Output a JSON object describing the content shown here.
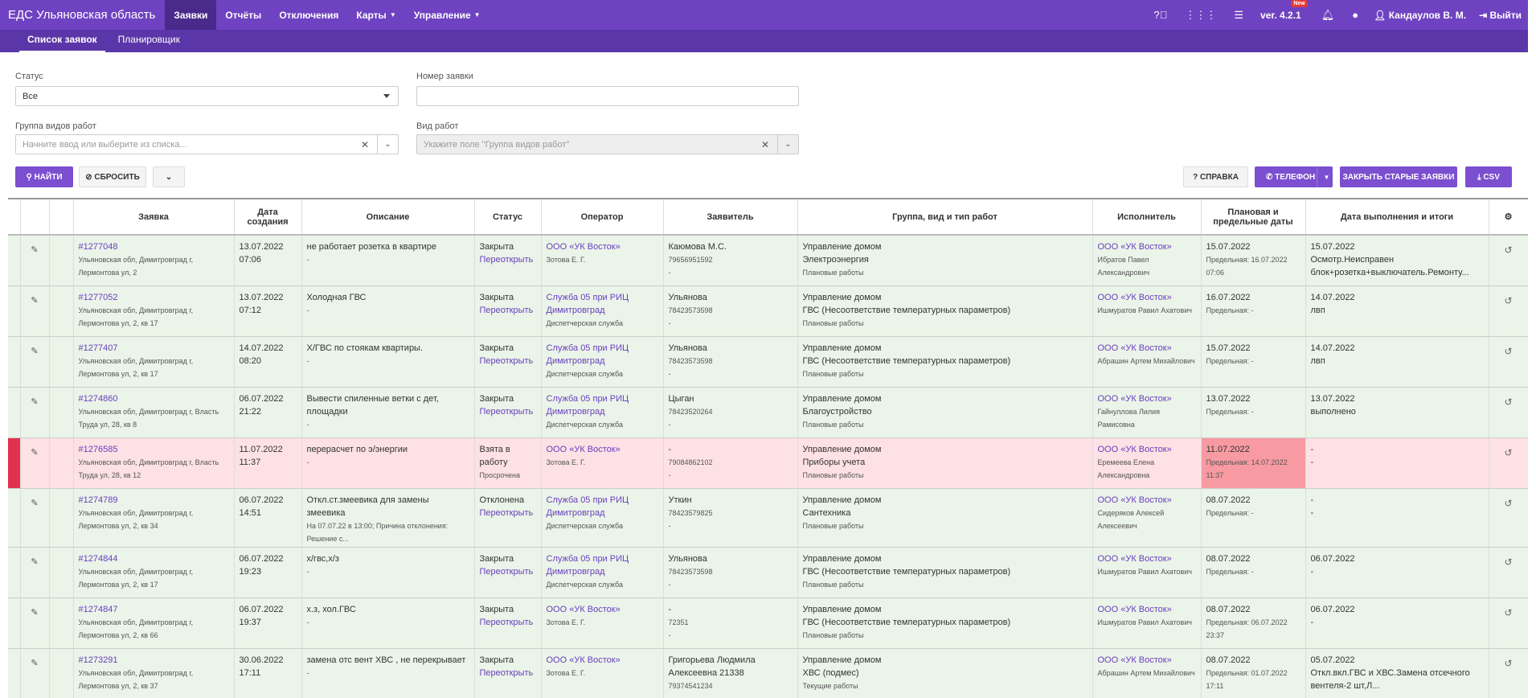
{
  "navbar": {
    "brand": "ЕДС Ульяновская область",
    "items": [
      "Заявки",
      "Отчёты",
      "Отключения",
      "Карты",
      "Управление"
    ],
    "version": "ver. 4.2.1",
    "new_badge": "New",
    "user": "Кандаулов В. М.",
    "logout": "Выйти"
  },
  "subnav": {
    "tabs": [
      "Список заявок",
      "Планировщик"
    ]
  },
  "filters": {
    "status_label": "Статус",
    "status_value": "Все",
    "number_label": "Номер заявки",
    "group_label": "Группа видов работ",
    "group_placeholder": "Начните ввод или выберите из списка...",
    "kind_label": "Вид работ",
    "kind_placeholder": "Укажите поле \"Группа видов работ\""
  },
  "buttons": {
    "find": "Найти",
    "reset": "Сбросить",
    "help": "Справка",
    "phone": "Телефон",
    "close_old": "Закрыть старые заявки",
    "csv": "CSV"
  },
  "table": {
    "headers": {
      "request": "Заявка",
      "created": "Дата создания",
      "description": "Описание",
      "status": "Статус",
      "operator": "Оператор",
      "applicant": "Заявитель",
      "group": "Группа, вид и тип работ",
      "executor": "Исполнитель",
      "plan": "Плановая и предельные даты",
      "done": "Дата выполнения и итоги"
    },
    "rows": [
      {
        "id": "#1277048",
        "addr": "Ульяновская обл, Димитровград г, Лермонтова ул, 2",
        "date": "13.07.2022",
        "time": "07:06",
        "desc": "не работает розетка в квартире",
        "desc2": "-",
        "status": "Закрыта",
        "status2": "Переоткрыть",
        "op": "ООО «УК Восток»",
        "op2": "Зотова Е. Г.",
        "app": "Каюмова М.С.",
        "app2": "79656951592",
        "app3": "-",
        "g1": "Управление домом",
        "g2": "Электроэнергия",
        "g3": "Плановые работы",
        "ex": "ООО «УК Восток»",
        "ex2": "Ибратов Павел Александрович",
        "p1": "15.07.2022",
        "p2": "Предельная: 16.07.2022 07:06",
        "d1": "15.07.2022",
        "d2": "Осмотр.Неисправен блок+розетка+выключатель.Ремонту..."
      },
      {
        "id": "#1277052",
        "addr": "Ульяновская обл, Димитровград г, Лермонтова ул, 2, кв 17",
        "date": "13.07.2022",
        "time": "07:12",
        "desc": "Холодная ГВС",
        "desc2": "-",
        "status": "Закрыта",
        "status2": "Переоткрыть",
        "op": "Служба 05 при РИЦ Димитровград",
        "op2": "Диспетчерская служба",
        "app": "Ульянова",
        "app2": "78423573598",
        "app3": "-",
        "g1": "Управление домом",
        "g2": "ГВС (Несоответствие температурных параметров)",
        "g3": "Плановые работы",
        "ex": "ООО «УК Восток»",
        "ex2": "Ишмуратов Равил Ахатович",
        "p1": "16.07.2022",
        "p2": "Предельная: -",
        "d1": "14.07.2022",
        "d2": "лвп"
      },
      {
        "id": "#1277407",
        "addr": "Ульяновская обл, Димитровград г, Лермонтова ул, 2, кв 17",
        "date": "14.07.2022",
        "time": "08:20",
        "desc": "Х/ГВС по стоякам квартиры.",
        "desc2": "-",
        "status": "Закрыта",
        "status2": "Переоткрыть",
        "op": "Служба 05 при РИЦ Димитровград",
        "op2": "Диспетчерская служба",
        "app": "Ульянова",
        "app2": "78423573598",
        "app3": "-",
        "g1": "Управление домом",
        "g2": "ГВС (Несоответствие температурных параметров)",
        "g3": "Плановые работы",
        "ex": "ООО «УК Восток»",
        "ex2": "Абрашин Артем Михайлович",
        "p1": "15.07.2022",
        "p2": "Предельная: -",
        "d1": "14.07.2022",
        "d2": "лвп"
      },
      {
        "id": "#1274860",
        "addr": "Ульяновская обл, Димитровград г, Власть Труда ул, 28, кв 8",
        "date": "06.07.2022",
        "time": "21:22",
        "desc": "Вывести спиленные ветки с дет, площадки",
        "desc2": "-",
        "status": "Закрыта",
        "status2": "Переоткрыть",
        "op": "Служба 05 при РИЦ Димитровград",
        "op2": "Диспетчерская служба",
        "app": "Цыган",
        "app2": "78423520264",
        "app3": "-",
        "g1": "Управление домом",
        "g2": "Благоустройство",
        "g3": "Плановые работы",
        "ex": "ООО «УК Восток»",
        "ex2": "Гайнуллова Лилия Рамисовна",
        "p1": "13.07.2022",
        "p2": "Предельная: -",
        "d1": "13.07.2022",
        "d2": "выполнено"
      },
      {
        "id": "#1276585",
        "addr": "Ульяновская обл, Димитровград г, Власть Труда ул, 28, кв 12",
        "date": "11.07.2022",
        "time": "11:37",
        "desc": "перерасчет по э/энергии",
        "desc2": "-",
        "status": "Взята в работу",
        "status2": "Просрочена",
        "op": "ООО «УК Восток»",
        "op2": "Зотова Е. Г.",
        "app": "-",
        "app2": "79084862102",
        "app3": "-",
        "g1": "Управление домом",
        "g2": "Приборы учета",
        "g3": "Плановые работы",
        "ex": "ООО «УК Восток»",
        "ex2": "Еремеева Елена Александровна",
        "p1": "11.07.2022",
        "p2": "Предельная: 14.07.2022 11:37",
        "d1": "-",
        "d2": "-"
      },
      {
        "id": "#1274789",
        "addr": "Ульяновская обл, Димитровград г, Лермонтова ул, 2, кв 34",
        "date": "06.07.2022",
        "time": "14:51",
        "desc": "Откл.ст.змеевика для замены змеевика",
        "desc2": "На 07.07.22 в 13:00; Причина отклонения: Решение с...",
        "status": "Отклонена",
        "status2": "Переоткрыть",
        "op": "Служба 05 при РИЦ Димитровград",
        "op2": "Диспетчерская служба",
        "app": "Уткин",
        "app2": "78423579825",
        "app3": "-",
        "g1": "Управление домом",
        "g2": "Сантехника",
        "g3": "Плановые работы",
        "ex": "ООО «УК Восток»",
        "ex2": "Сидеряков Алексей Алексеевич",
        "p1": "08.07.2022",
        "p2": "Предельная: -",
        "d1": "-",
        "d2": "-"
      },
      {
        "id": "#1274844",
        "addr": "Ульяновская обл, Димитровград г, Лермонтова ул, 2, кв 17",
        "date": "06.07.2022",
        "time": "19:23",
        "desc": "х/гвс,х/з",
        "desc2": "-",
        "status": "Закрыта",
        "status2": "Переоткрыть",
        "op": "Служба 05 при РИЦ Димитровград",
        "op2": "Диспетчерская служба",
        "app": "Ульянова",
        "app2": "78423573598",
        "app3": "-",
        "g1": "Управление домом",
        "g2": "ГВС (Несоответствие температурных параметров)",
        "g3": "Плановые работы",
        "ex": "ООО «УК Восток»",
        "ex2": "Ишмуратов Равил Ахатович",
        "p1": "08.07.2022",
        "p2": "Предельная: -",
        "d1": "06.07.2022",
        "d2": "-"
      },
      {
        "id": "#1274847",
        "addr": "Ульяновская обл, Димитровград г, Лермонтова ул, 2, кв 66",
        "date": "06.07.2022",
        "time": "19:37",
        "desc": "х.з, хол.ГВС",
        "desc2": "-",
        "status": "Закрыта",
        "status2": "Переоткрыть",
        "op": "ООО «УК Восток»",
        "op2": "Зотова Е. Г.",
        "app": "-",
        "app2": "72351",
        "app3": "-",
        "g1": "Управление домом",
        "g2": "ГВС (Несоответствие температурных параметров)",
        "g3": "Плановые работы",
        "ex": "ООО «УК Восток»",
        "ex2": "Ишмуратов Равил Ахатович",
        "p1": "08.07.2022",
        "p2": "Предельная: 06.07.2022 23:37",
        "d1": "06.07.2022",
        "d2": "-"
      },
      {
        "id": "#1273291",
        "addr": "Ульяновская обл, Димитровград г, Лермонтова ул, 2, кв 37",
        "date": "30.06.2022",
        "time": "17:11",
        "desc": "замена отс вент ХВС , не перекрывает",
        "desc2": "-",
        "status": "Закрыта",
        "status2": "Переоткрыть",
        "op": "ООО «УК Восток»",
        "op2": "Зотова Е. Г.",
        "app": "Григорьева Людмила Алексеевна 21338",
        "app2": "79374541234",
        "app3": "-",
        "g1": "Управление домом",
        "g2": "ХВС (подмес)",
        "g3": "Текущие работы",
        "ex": "ООО «УК Восток»",
        "ex2": "Абрашин Артем Михайлович",
        "p1": "08.07.2022",
        "p2": "Предельная: 01.07.2022 17:11",
        "d1": "05.07.2022",
        "d2": "Откл.вкл.ГВС и ХВС.Замена отсечного вентеля-2 шт,Л..."
      }
    ]
  }
}
